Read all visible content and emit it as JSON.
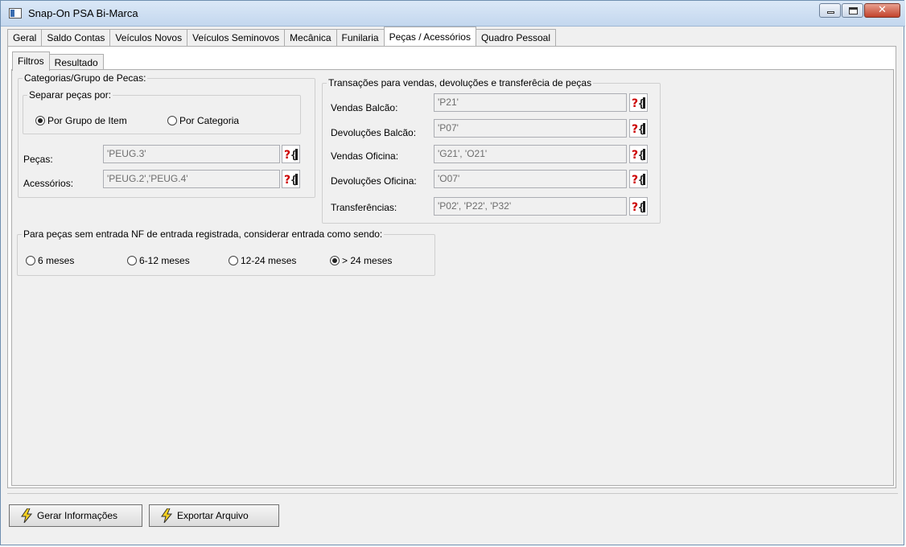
{
  "window": {
    "title": "Snap-On PSA Bi-Marca"
  },
  "tabs": [
    "Geral",
    "Saldo Contas",
    "Veículos Novos",
    "Veículos Seminovos",
    "Mecânica",
    "Funilaria",
    "Peças / Acessórios",
    "Quadro Pessoal"
  ],
  "active_tab": "Peças / Acessórios",
  "subtabs": [
    "Filtros",
    "Resultado"
  ],
  "active_subtab": "Filtros",
  "categorias": {
    "legend": "Categorias/Grupo de Pecas:",
    "separar_legend": "Separar peças por:",
    "option_grupo": "Por Grupo de Item",
    "option_categoria": "Por Categoria",
    "selected": "Por Grupo de Item",
    "pecas_label": "Peças:",
    "pecas_value": "'PEUG.3'",
    "acessorios_label": "Acessórios:",
    "acessorios_value": "'PEUG.2','PEUG.4'"
  },
  "transacoes": {
    "legend": "Transações para vendas, devoluções e transferêcia de peças",
    "rows": [
      {
        "label": "Vendas Balcão:",
        "value": "'P21'"
      },
      {
        "label": "Devoluções Balcão:",
        "value": "'P07'"
      },
      {
        "label": "Vendas Oficina:",
        "value": "'G21', 'O21'"
      },
      {
        "label": "Devoluções Oficina:",
        "value": "'O07'"
      },
      {
        "label": "Transferências:",
        "value": "'P02', 'P22', 'P32'"
      }
    ]
  },
  "entrada": {
    "legend": "Para peças sem entrada NF de entrada registrada, considerar entrada como sendo:",
    "options": [
      "6 meses",
      "6-12 meses",
      "12-24 meses",
      "> 24 meses"
    ],
    "selected": "> 24 meses"
  },
  "buttons": {
    "gerar": "Gerar Informações",
    "exportar": "Exportar Arquivo"
  },
  "icons": {
    "help_lookup": "help-lookup-icon",
    "lightning": "lightning-icon"
  },
  "colors": {
    "help_red": "#cc0000",
    "lightning_yellow": "#f5d020"
  }
}
